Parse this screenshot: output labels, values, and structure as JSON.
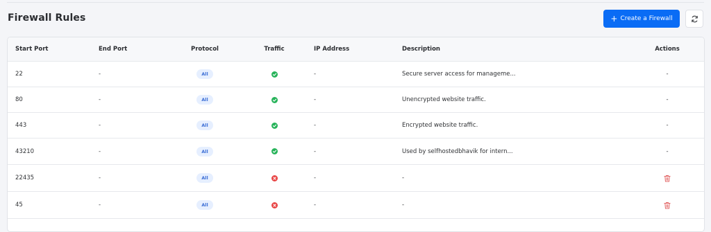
{
  "header": {
    "title": "Firewall Rules",
    "create_button_label": "Create a Firewall",
    "create_button_icon": "plus-icon",
    "refresh_icon": "refresh-icon"
  },
  "table": {
    "columns": [
      "Start Port",
      "End Port",
      "Protocol",
      "Traffic",
      "IP Address",
      "Description",
      "Actions"
    ],
    "rows": [
      {
        "start_port": "22",
        "end_port": "-",
        "protocol": "All",
        "traffic": "allowed",
        "ip_address": "-",
        "description": "Secure server access for manageme...",
        "action": "-"
      },
      {
        "start_port": "80",
        "end_port": "-",
        "protocol": "All",
        "traffic": "allowed",
        "ip_address": "-",
        "description": "Unencrypted website traffic.",
        "action": "-"
      },
      {
        "start_port": "443",
        "end_port": "-",
        "protocol": "All",
        "traffic": "allowed",
        "ip_address": "-",
        "description": "Encrypted website traffic.",
        "action": "-"
      },
      {
        "start_port": "43210",
        "end_port": "-",
        "protocol": "All",
        "traffic": "allowed",
        "ip_address": "-",
        "description": "Used by selfhostedbhavik for intern...",
        "action": "-"
      },
      {
        "start_port": "22435",
        "end_port": "-",
        "protocol": "All",
        "traffic": "blocked",
        "ip_address": "-",
        "description": "-",
        "action": "trash-icon"
      },
      {
        "start_port": "45",
        "end_port": "-",
        "protocol": "All",
        "traffic": "blocked",
        "ip_address": "-",
        "description": "-",
        "action": "trash-icon"
      }
    ]
  },
  "colors": {
    "accent": "#0a6cf5",
    "allowed": "#27b35a",
    "blocked": "#e84545",
    "delete": "#e05a5a"
  }
}
